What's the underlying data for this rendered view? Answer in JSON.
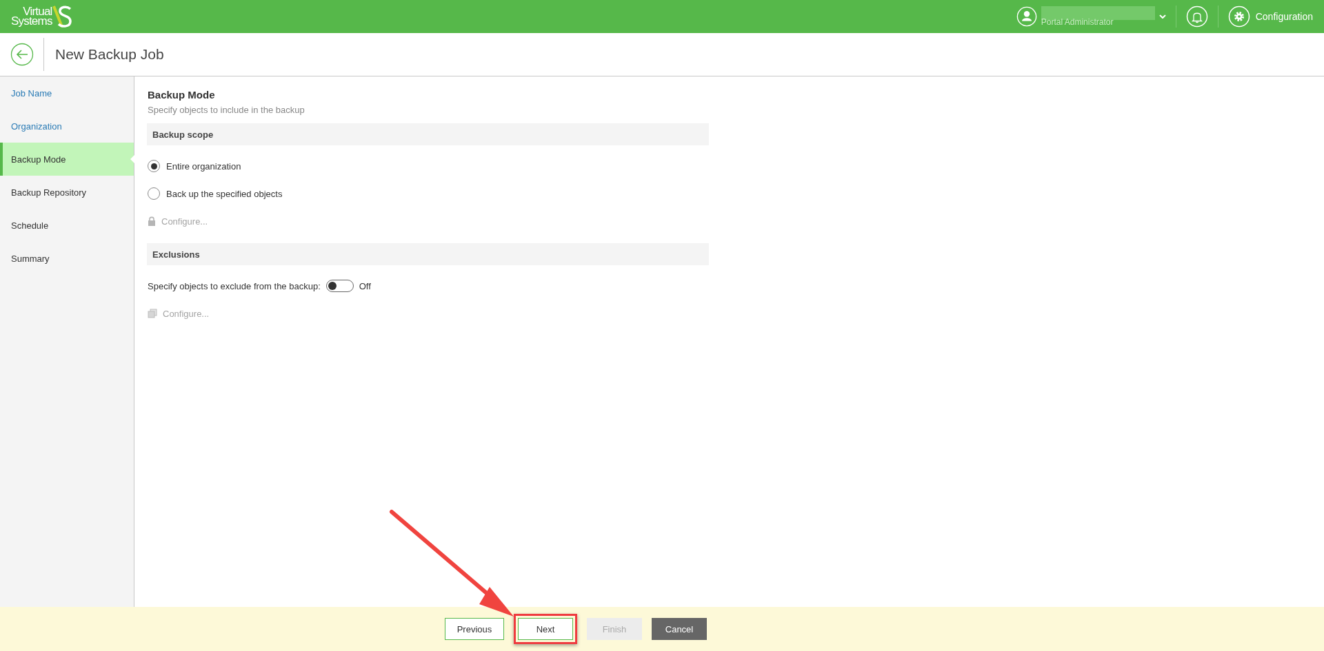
{
  "top_bar": {
    "logo": {
      "line_1": "Virtual",
      "line_2": "Systems"
    },
    "user": {
      "role": "Portal Administrator"
    },
    "configuration_label": "Configuration"
  },
  "header": {
    "title": "New Backup Job"
  },
  "sidebar": {
    "items": [
      {
        "label": "Job Name",
        "selected": false,
        "completed": true
      },
      {
        "label": "Organization",
        "selected": false,
        "completed": true
      },
      {
        "label": "Backup Mode",
        "selected": true,
        "completed": false
      },
      {
        "label": "Backup Repository",
        "selected": false,
        "completed": false
      },
      {
        "label": "Schedule",
        "selected": false,
        "completed": false
      },
      {
        "label": "Summary",
        "selected": false,
        "completed": false
      }
    ]
  },
  "content": {
    "title": "Backup Mode",
    "subtitle": "Specify objects to include in the backup",
    "scope": {
      "heading": "Backup scope",
      "options": [
        {
          "label": "Entire organization",
          "selected": true
        },
        {
          "label": "Back up the specified objects",
          "selected": false
        }
      ],
      "configure": {
        "label": "Configure...",
        "disabled": true
      }
    },
    "exclusions": {
      "heading": "Exclusions",
      "toggle_label": "Specify objects to exclude from the backup:",
      "toggle": {
        "on": false,
        "state_text": "Off"
      },
      "configure": {
        "label": "Configure...",
        "disabled": true
      }
    }
  },
  "footer": {
    "buttons": [
      {
        "label": "Previous",
        "kind": "outline",
        "disabled": false,
        "highlighted": false
      },
      {
        "label": "Next",
        "kind": "outline",
        "disabled": false,
        "highlighted": true
      },
      {
        "label": "Finish",
        "kind": "primary",
        "disabled": true,
        "highlighted": false
      },
      {
        "label": "Cancel",
        "kind": "dark",
        "disabled": false,
        "highlighted": false
      }
    ]
  }
}
